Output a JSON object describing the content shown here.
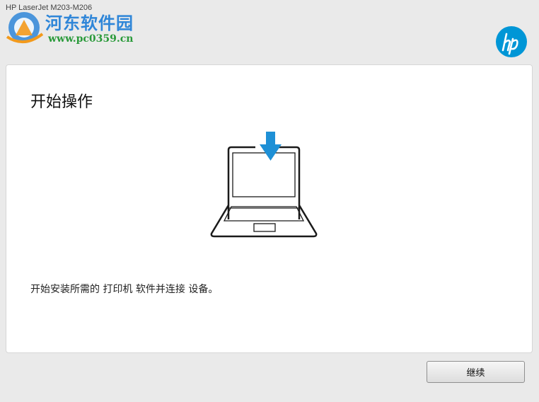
{
  "window": {
    "title": "HP LaserJet M203-M206"
  },
  "watermark": {
    "name": "河东软件园",
    "url": "www.pc0359.cn"
  },
  "brand": {
    "logo_icon": "hp-logo-icon",
    "color": "#0096d6"
  },
  "main": {
    "heading": "开始操作",
    "illustration_icon": "laptop-download-icon",
    "description": "开始安装所需的 打印机 软件并连接 设备。"
  },
  "footer": {
    "continue_label": "继续"
  },
  "colors": {
    "accent": "#1e90d6",
    "background": "#eaeaea",
    "panel": "#ffffff"
  }
}
